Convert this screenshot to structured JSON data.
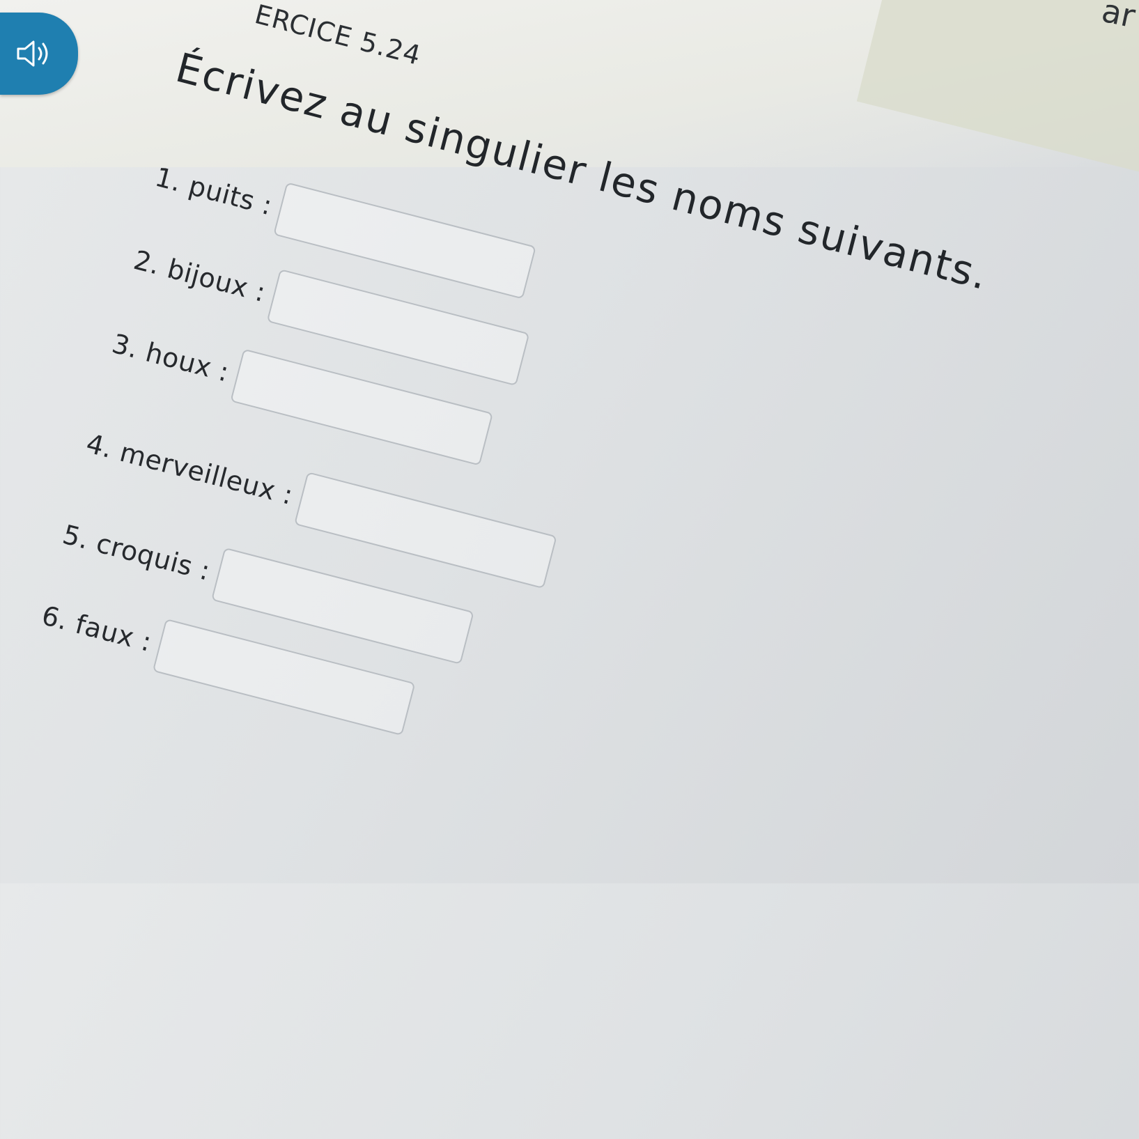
{
  "header": {
    "exercise_label": "ERCICE 5.24",
    "corner_text": "ar"
  },
  "audio": {
    "icon": "speaker-icon",
    "color": "#1f7fb0"
  },
  "instruction": "Écrivez au singulier les noms suivants.",
  "items": [
    {
      "label": "1. puits :",
      "value": ""
    },
    {
      "label": "2. bijoux :",
      "value": ""
    },
    {
      "label": "3. houx :",
      "value": ""
    },
    {
      "label": "4. merveilleux :",
      "value": ""
    },
    {
      "label": "5. croquis :",
      "value": ""
    },
    {
      "label": "6. faux :",
      "value": ""
    }
  ]
}
